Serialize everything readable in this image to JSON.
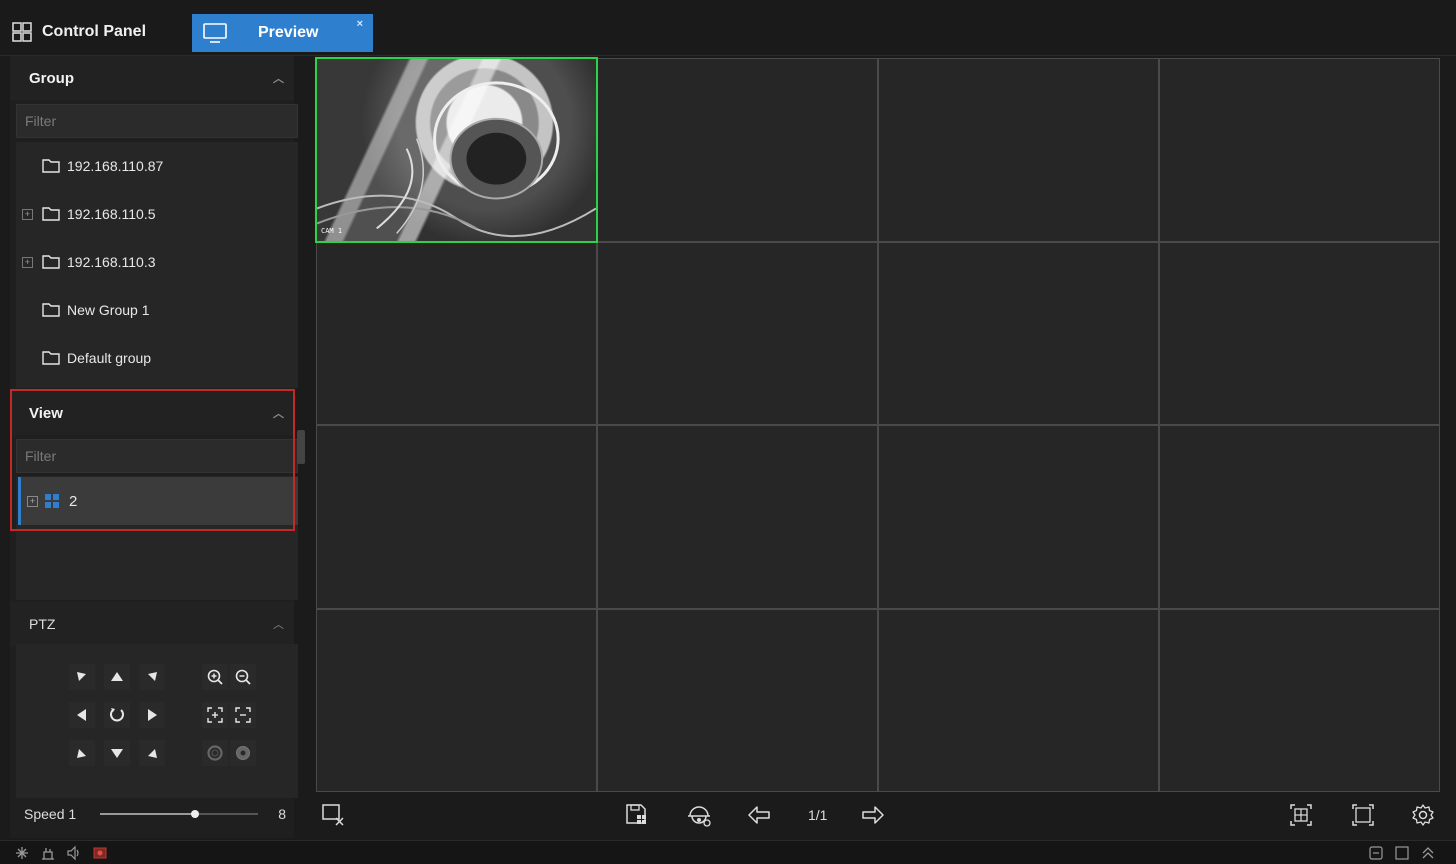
{
  "tabs": {
    "control_panel": "Control Panel",
    "preview": "Preview",
    "close": "×"
  },
  "group": {
    "title": "Group",
    "filter_placeholder": "Filter",
    "items": [
      {
        "label": "192.168.110.87",
        "expandable": false
      },
      {
        "label": "192.168.110.5",
        "expandable": true
      },
      {
        "label": "192.168.110.3",
        "expandable": true
      },
      {
        "label": "New Group 1",
        "expandable": false
      },
      {
        "label": "Default group",
        "expandable": false
      }
    ]
  },
  "view": {
    "title": "View",
    "filter_placeholder": "Filter",
    "items": [
      {
        "label": "2",
        "selected": true
      }
    ]
  },
  "ptz": {
    "title": "PTZ",
    "speed_label": "Speed",
    "speed_value": "1",
    "speed_max": "8"
  },
  "grid": {
    "layout": "4x4",
    "camera_caption": "CAM 1"
  },
  "toolbar": {
    "page_indicator": "1/1"
  },
  "colors": {
    "accent": "#2f7fcf",
    "active_cell": "#2bd24a",
    "highlight": "#c62828"
  }
}
